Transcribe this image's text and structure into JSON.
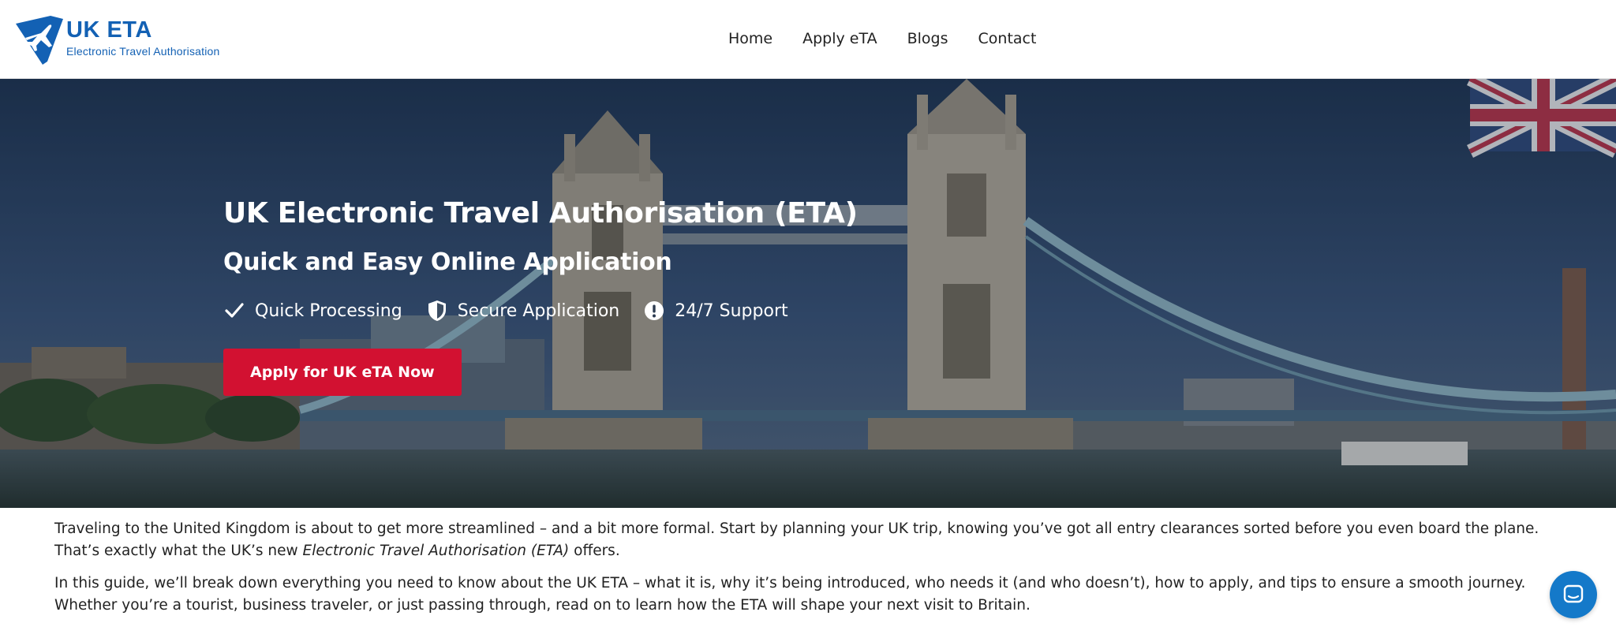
{
  "header": {
    "logo_title": "UK ETA",
    "logo_subtitle": "Electronic Travel Authorisation",
    "nav": [
      {
        "label": "Home"
      },
      {
        "label": "Apply eTA"
      },
      {
        "label": "Blogs"
      },
      {
        "label": "Contact"
      }
    ]
  },
  "hero": {
    "title": "UK Electronic Travel Authorisation (ETA)",
    "subtitle": "Quick and Easy Online Application",
    "features": [
      {
        "label": "Quick Processing",
        "icon": "check-icon"
      },
      {
        "label": "Secure Application",
        "icon": "shield-icon"
      },
      {
        "label": "24/7 Support",
        "icon": "exclamation-circle-icon"
      }
    ],
    "cta_label": "Apply for UK eTA Now"
  },
  "article": {
    "p1_part1": "Traveling to the United Kingdom is about to get more streamlined – and a bit more formal. Start by planning your UK trip, knowing you’ve got all entry clearances sorted before you even board the plane. That’s exactly what the UK’s new ",
    "p1_em": "Electronic Travel Authorisation (ETA)",
    "p1_part2": " offers.",
    "p2": "In this guide, we’ll break down everything you need to know about the UK ETA – what it is, why it’s being introduced, who needs it (and who doesn’t), how to apply, and tips to ensure a smooth journey. Whether you’re a tourist, business traveler, or just passing through, read on to learn how the ETA will shape your next visit to Britain."
  },
  "colors": {
    "brand_blue": "#1361b4",
    "cta_red": "#d21131",
    "chat_blue": "#1479c9"
  }
}
